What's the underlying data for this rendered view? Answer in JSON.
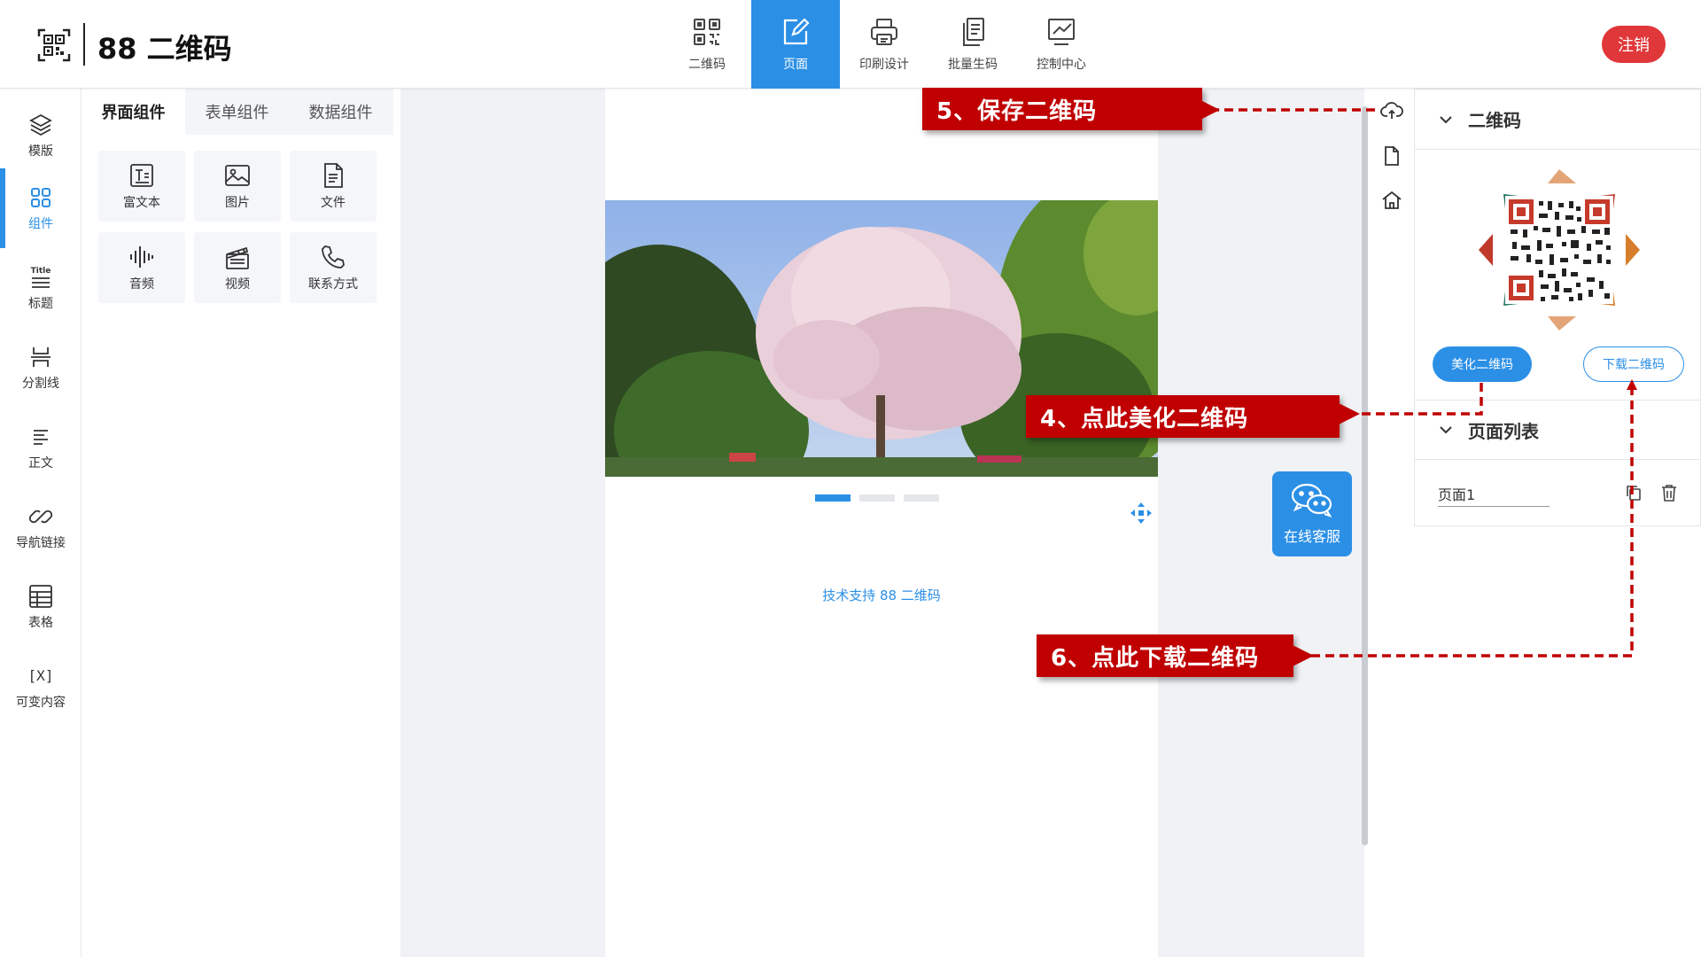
{
  "app": {
    "title": "88 二维码"
  },
  "nav": [
    {
      "label": "二维码",
      "icon": "qrcode-icon",
      "active": false
    },
    {
      "label": "页面",
      "icon": "edit-icon",
      "active": true
    },
    {
      "label": "印刷设计",
      "icon": "printer-icon",
      "active": false
    },
    {
      "label": "批量生码",
      "icon": "documents-icon",
      "active": false
    },
    {
      "label": "控制中心",
      "icon": "chart-icon",
      "active": false
    }
  ],
  "header": {
    "logout_label": "注销"
  },
  "sidebar": {
    "items": [
      {
        "label": "模版",
        "icon": "layers-icon"
      },
      {
        "label": "组件",
        "icon": "grid-icon"
      },
      {
        "label": "标题",
        "icon": "title-icon",
        "icon_text": "Title"
      },
      {
        "label": "分割线",
        "icon": "divider-icon"
      },
      {
        "label": "正文",
        "icon": "paragraph-icon"
      },
      {
        "label": "导航链接",
        "icon": "link-icon"
      },
      {
        "label": "表格",
        "icon": "table-icon"
      },
      {
        "label": "可变内容",
        "icon": "variable-icon",
        "icon_text": "[X]"
      }
    ]
  },
  "components": {
    "tabs": [
      "界面组件",
      "表单组件",
      "数据组件"
    ],
    "items": [
      {
        "label": "富文本",
        "icon": "richtext-icon"
      },
      {
        "label": "图片",
        "icon": "image-icon"
      },
      {
        "label": "文件",
        "icon": "file-icon"
      },
      {
        "label": "音频",
        "icon": "audio-icon"
      },
      {
        "label": "视频",
        "icon": "video-icon"
      },
      {
        "label": "联系方式",
        "icon": "phone-icon"
      }
    ]
  },
  "canvas": {
    "support_text": "技术支持 88 二维码",
    "carousel_dots": 3,
    "carousel_active": 0,
    "wechat_label": "在线客服"
  },
  "right_panel": {
    "qr_section_title": "二维码",
    "beautify_label": "美化二维码",
    "download_label": "下载二维码",
    "page_list_title": "页面列表",
    "pages": [
      "页面1"
    ]
  },
  "annotations": {
    "save": "5、保存二维码",
    "beautify": "4、点此美化二维码",
    "download": "6、点此下载二维码"
  },
  "colors": {
    "accent": "#2b8fe6",
    "logout": "#e0373a",
    "callout": "#c00000"
  }
}
